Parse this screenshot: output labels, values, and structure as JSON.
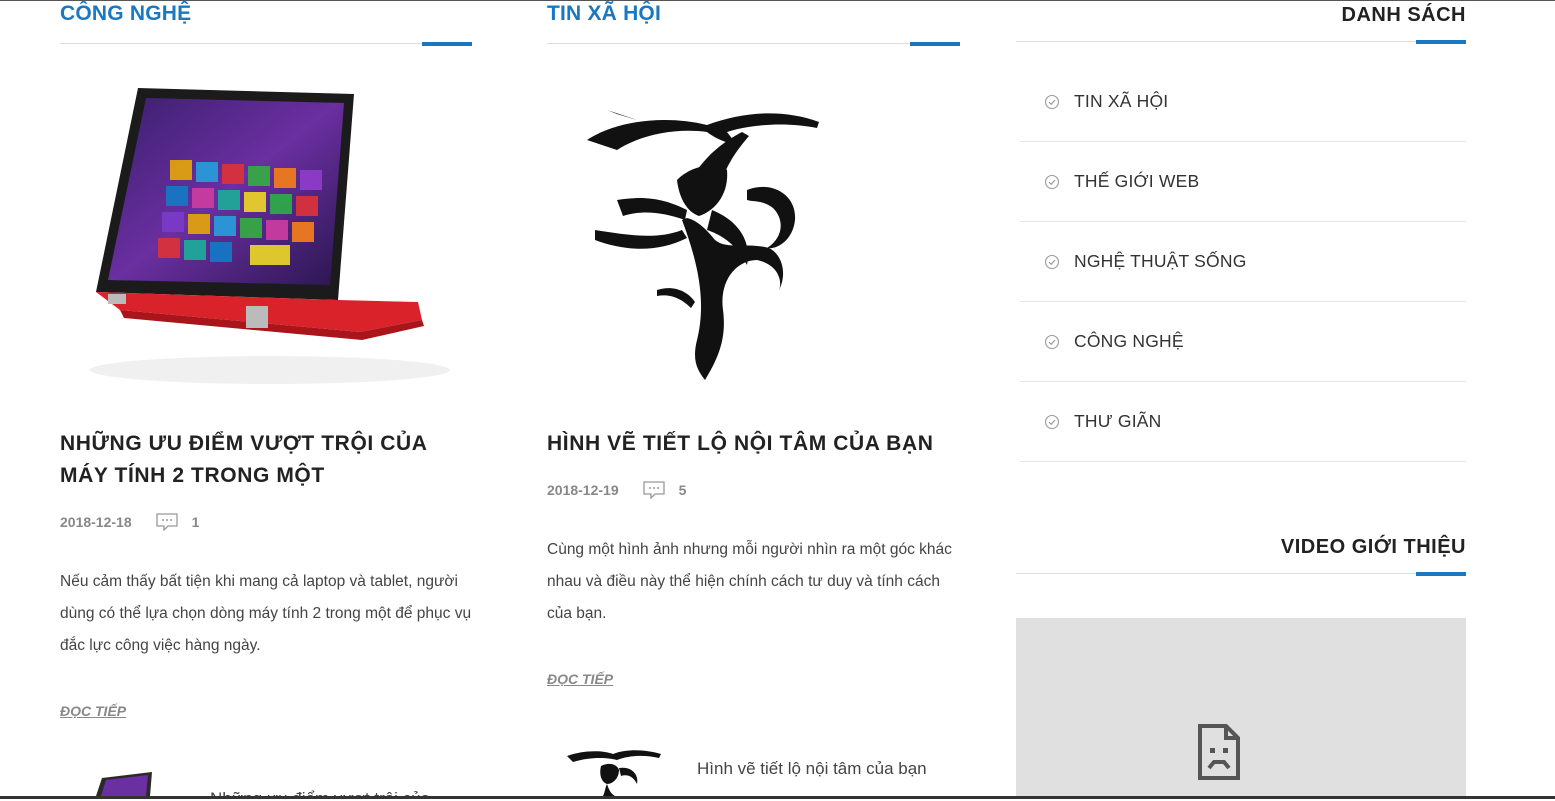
{
  "col1": {
    "section_title": "CÔNG NGHỆ",
    "image_desc_icon": "laptop-image",
    "post_title": "NHỮNG ƯU ĐIỂM VƯỢT TRỘI CỦA MÁY TÍNH 2 TRONG MỘT",
    "date": "2018-12-18",
    "comments": "1",
    "excerpt": "Nếu cảm thấy bất tiện khi mang cả laptop và tablet, người dùng có thể lựa chọn dòng máy tính 2 trong một để phục vụ đắc lực công việc hàng ngày.",
    "read_more": "ĐỌC TIẾP",
    "mini_title": "Những ưu điểm vượt trội của"
  },
  "col2": {
    "section_title": "TIN XÃ HỘI",
    "image_desc_icon": "tree-monkey-image",
    "post_title": "HÌNH VẼ TIẾT LỘ NỘI TÂM CỦA BẠN",
    "date": "2018-12-19",
    "comments": "5",
    "excerpt": "Cùng một hình ảnh nhưng mỗi người nhìn ra một góc khác nhau và điều này thể hiện chính cách tư duy và tính cách của bạn.",
    "read_more": "ĐỌC TIẾP",
    "mini_title": "Hình vẽ tiết lộ nội tâm của bạn"
  },
  "sidebar": {
    "list_title": "DANH SÁCH",
    "categories": [
      {
        "label": "TIN XÃ HỘI"
      },
      {
        "label": "THẾ GIỚI WEB"
      },
      {
        "label": "NGHỆ THUẬT SỐNG"
      },
      {
        "label": "CÔNG NGHỆ"
      },
      {
        "label": "THƯ GIÃN"
      }
    ],
    "video_title": "VIDEO GIỚI THIỆU",
    "video_icon": "broken-document-icon"
  },
  "colors": {
    "accent": "#1a78c2",
    "text": "#222222",
    "muted": "#888888",
    "laptop_red": "#d9222a"
  }
}
